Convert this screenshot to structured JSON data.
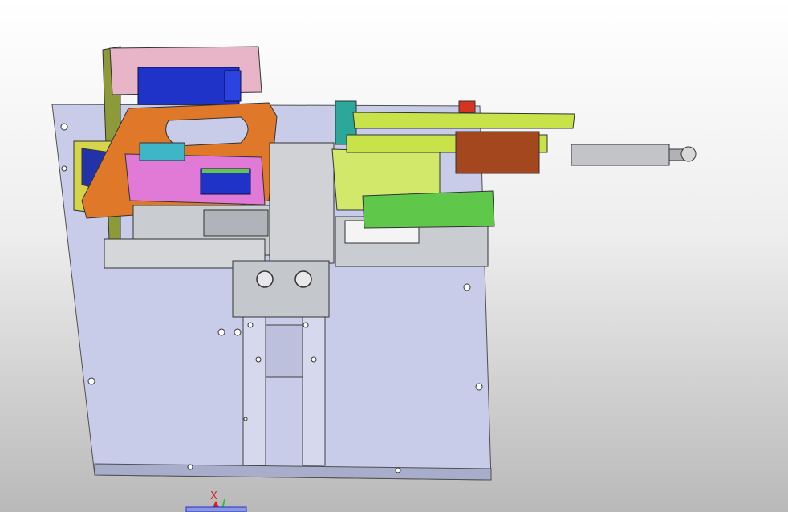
{
  "viewport": {
    "title": "",
    "background_top": "#ffffff",
    "background_bottom": "#b9b9b9"
  },
  "model": {
    "colors": {
      "base_plate": "#c8cce8",
      "base_plate_edge": "#9ea3c4",
      "pink": "#e8b4c8",
      "magenta": "#e07ad6",
      "orange": "#e0782a",
      "blue_cylinder": "#1f33c9",
      "yellow_green": "#c8e24a",
      "green": "#5fc84a",
      "brown": "#a4461e",
      "olive": "#8c9a3a",
      "teal": "#2ba89a",
      "yellow": "#d6d44a",
      "red": "#d8331e",
      "steel": "#c9ccd1",
      "white": "#f4f4f4"
    }
  },
  "triad": {
    "x_label": "X",
    "x_color": "#d81e1e",
    "y_color": "#2ec03c",
    "z_color": "#2030c8",
    "icons": [
      "coordinate-triad-icon"
    ]
  }
}
